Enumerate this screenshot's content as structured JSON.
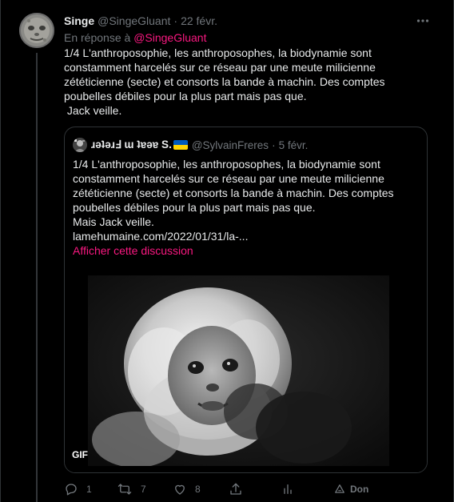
{
  "tweet": {
    "author_name": "Singe",
    "author_handle": "@SingeGluant",
    "date": "22 févr.",
    "separator": "·",
    "reply_prefix": "En réponse à",
    "reply_mention": "@SingeGluant",
    "text": "1/4 L'anthroposophie, les anthroposophes, la biodynamie sont constamment harcelés sur ce réseau par une meute milicienne zététicienne (secte) et consorts la bande à machin. Des comptes poubelles débiles pour la plus part mais pas que.\n Jack veille."
  },
  "quote": {
    "author_name": "ɹǝʇǝɹℲ ɯ ʇɐǝɐ S.",
    "author_handle": "@SylvainFreres",
    "date": "5 févr.",
    "separator": "·",
    "text": "1/4 L'anthroposophie, les anthroposophes, la biodynamie sont constamment harcelés sur ce réseau par une meute milicienne zététicienne (secte) et consorts la bande à machin. Des comptes poubelles débiles pour la plus part mais pas que.\nMais Jack veille.",
    "link": "lamehumaine.com/2022/01/31/la-...",
    "discussion_label": "Afficher cette discussion",
    "gif_badge": "GIF"
  },
  "actions": {
    "reply_count": "1",
    "retweet_count": "7",
    "like_count": "8",
    "donate_label": "Don"
  },
  "colors": {
    "background": "#000000",
    "text": "#e7e9ea",
    "secondary": "#71767b",
    "accent": "#f91880",
    "border": "#2f3336"
  },
  "icons": [
    "more-icon",
    "reply-icon",
    "retweet-icon",
    "like-icon",
    "share-icon",
    "analytics-icon",
    "donate-icon",
    "ukraine-flag-icon"
  ]
}
